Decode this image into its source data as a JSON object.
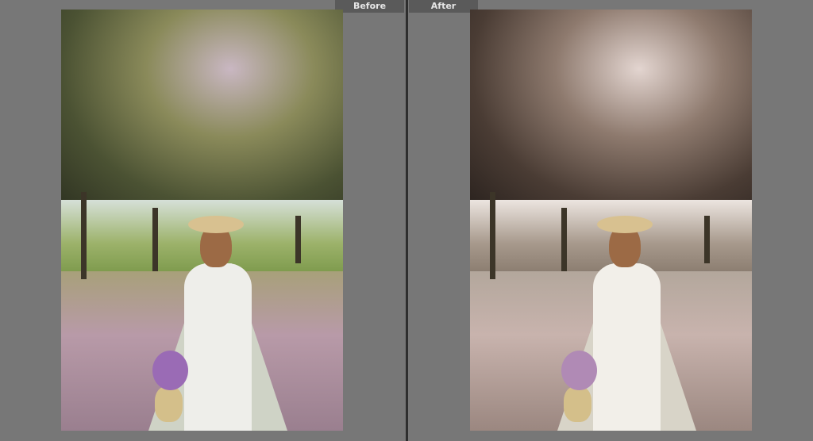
{
  "compare_view": {
    "before_label": "Before",
    "after_label": "After"
  }
}
